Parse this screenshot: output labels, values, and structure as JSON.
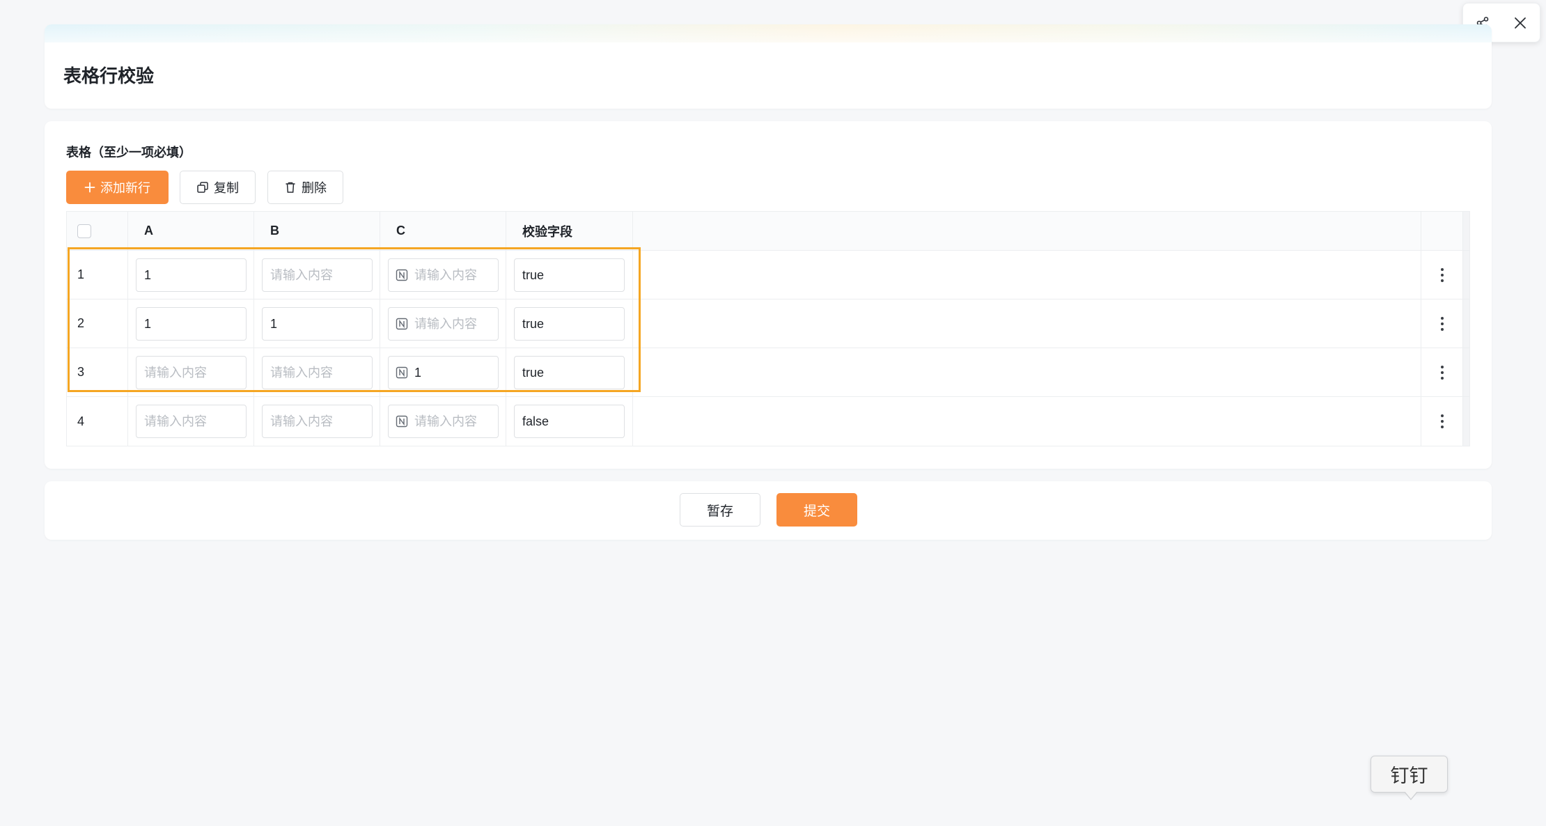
{
  "window_controls": {
    "share_icon": "share-icon",
    "close_icon": "close-icon"
  },
  "header": {
    "title": "表格行校验"
  },
  "form": {
    "field_label": "表格（至少一项必填）",
    "toolbar": {
      "add_label": "添加新行",
      "copy_label": "复制",
      "delete_label": "删除"
    },
    "table": {
      "placeholder": "请输入内容",
      "columns": [
        "A",
        "B",
        "C",
        "校验字段"
      ],
      "rows": [
        {
          "index": "1",
          "a": "1",
          "check": "true"
        },
        {
          "index": "2",
          "a": "1",
          "b": "1",
          "check": "true"
        },
        {
          "index": "3",
          "c": "1",
          "check": "true"
        },
        {
          "index": "4",
          "check": "false"
        }
      ]
    }
  },
  "footer": {
    "save_label": "暂存",
    "submit_label": "提交"
  },
  "tooltip": {
    "text": "钉钉"
  },
  "colors": {
    "accent": "#f98c3d",
    "highlight": "#f5a623"
  }
}
